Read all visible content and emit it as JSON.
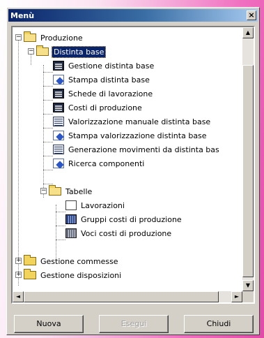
{
  "window": {
    "title": "Menù",
    "close_label": "×"
  },
  "tree": [
    {
      "id": "produzione",
      "label": "Produzione",
      "icon": "folder-open-icon",
      "expander": "−"
    },
    {
      "id": "distinta-base",
      "label": "Distinta base",
      "icon": "folder-open-icon",
      "expander": "−",
      "selected": true
    },
    {
      "id": "gestione-distinta",
      "label": "Gestione distinta base",
      "icon": "form-dark-icon"
    },
    {
      "id": "stampa-distinta",
      "label": "Stampa distinta base",
      "icon": "print-icon"
    },
    {
      "id": "schede-lavorazione",
      "label": "Schede di lavorazione",
      "icon": "form-dark-icon"
    },
    {
      "id": "costi-produzione",
      "label": "Costi di produzione",
      "icon": "form-dark-icon"
    },
    {
      "id": "valorizzazione-manuale",
      "label": "Valorizzazione manuale distinta base",
      "icon": "form-grid-icon"
    },
    {
      "id": "stampa-valorizzazione",
      "label": "Stampa valorizzazione distinta base",
      "icon": "print-icon"
    },
    {
      "id": "generazione-movimenti",
      "label": "Generazione movimenti da distinta bas",
      "icon": "form-grid-icon"
    },
    {
      "id": "ricerca-componenti",
      "label": "Ricerca componenti",
      "icon": "print-icon"
    },
    {
      "id": "tabelle",
      "label": "Tabelle",
      "icon": "folder-open-icon",
      "expander": "−"
    },
    {
      "id": "lavorazioni",
      "label": "Lavorazioni",
      "icon": "blank-doc-icon"
    },
    {
      "id": "gruppi-costi",
      "label": "Gruppi costi di produzione",
      "icon": "table-blue-icon"
    },
    {
      "id": "voci-costi",
      "label": "Voci costi di produzione",
      "icon": "table-grey-icon"
    },
    {
      "id": "gestione-commesse",
      "label": "Gestione commesse",
      "icon": "folder-icon",
      "expander": "+"
    },
    {
      "id": "gestione-disposizioni",
      "label": "Gestione disposizioni",
      "icon": "folder-icon",
      "expander": "+"
    }
  ],
  "scroll": {
    "up": "▲",
    "down": "▼",
    "left": "◄",
    "right": "►"
  },
  "buttons": {
    "new": "Nuova",
    "search": "Esegui",
    "close": "Chiudi"
  }
}
